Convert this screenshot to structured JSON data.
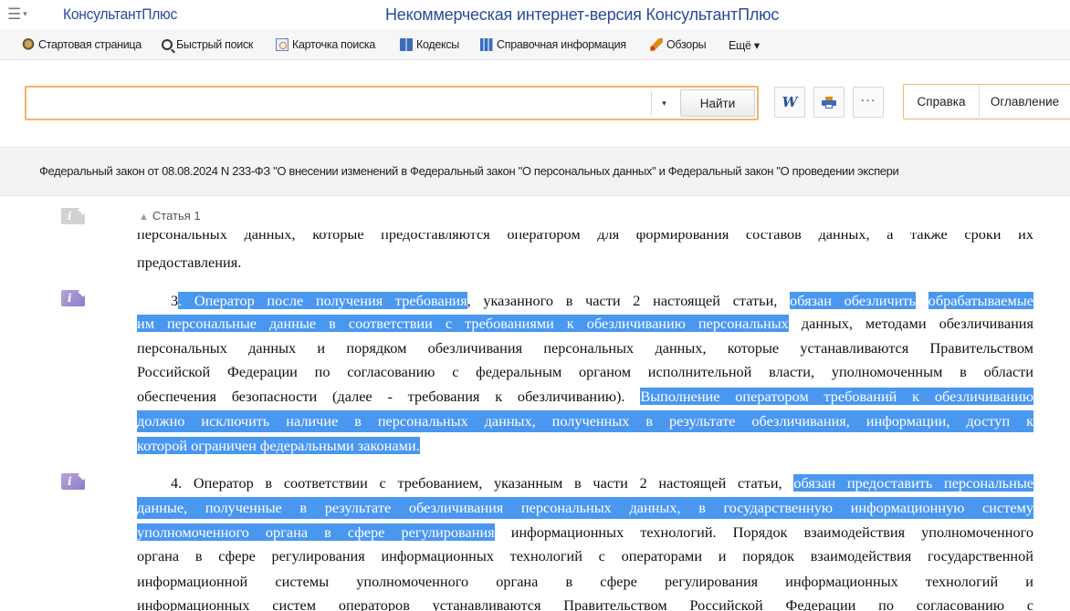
{
  "titlebar": {
    "brand": "КонсультантПлюс",
    "title": "Некоммерческая интернет-версия КонсультантПлюс",
    "menu_icon": "hamburger-menu-icon"
  },
  "toolbar": {
    "items": [
      {
        "label": "Стартовая страница",
        "icon": "home-icon"
      },
      {
        "label": "Быстрый поиск",
        "icon": "search-icon"
      },
      {
        "label": "Карточка поиска",
        "icon": "search-card-icon"
      },
      {
        "label": "Кодексы",
        "icon": "book-icon"
      },
      {
        "label": "Справочная информация",
        "icon": "reference-icon"
      },
      {
        "label": "Обзоры",
        "icon": "pen-icon"
      },
      {
        "label": "Ещё ▾",
        "icon": ""
      }
    ]
  },
  "search": {
    "value": "",
    "placeholder": "",
    "dropdown": "▾",
    "find_label": "Найти"
  },
  "actions": {
    "word_label": "W",
    "more_label": "···",
    "help_label": "Справка",
    "contents_label": "Оглавление"
  },
  "document": {
    "title": "Федеральный закон от 08.08.2024 N 233-ФЗ \"О внесении изменений в Федеральный закон \"О персональных данных\" и Федеральный закон \"О проведении экспери",
    "article_link": "Статья 1"
  },
  "body": {
    "cut_line": "персональных данных, которые предоставляются оператором для формирования составов данных, а также сроки их",
    "p2_end": "предоставления.",
    "p3": {
      "l1": [
        {
          "t": "3",
          "h": false
        },
        {
          "t": ". Оператор после получения требования",
          "h": true
        },
        {
          "t": ", указанного в части 2 настоящей статьи, ",
          "h": false
        },
        {
          "t": "обязан обезличить",
          "h": true
        },
        {
          "t": " ",
          "h": false
        },
        {
          "t": "обрабатываемые",
          "h": true
        }
      ],
      "l2": [
        {
          "t": "им персональные данные в соответствии с требованиями к обезличиванию персональных",
          "h": true
        },
        {
          "t": " данных, методами обезличивания",
          "h": false
        }
      ],
      "l3": "персональных данных и порядком обезличивания персональных данных, которые устанавливаются Правительством",
      "l4": "Российской Федерации по согласованию с федеральным органом исполнительной власти, уполномоченным в области",
      "l5": [
        {
          "t": "обеспечения безопасности (далее - требования к обезличиванию). ",
          "h": false
        },
        {
          "t": "Выполнение оператором требований к обезличиванию",
          "h": true
        }
      ],
      "l6": "должно исключить наличие в персональных данных, полученных в результате обезличивания, информации, доступ к",
      "l7": "которой ограничен федеральными законами."
    },
    "p4": {
      "l1": [
        {
          "t": "4. Оператор в соответствии с требованием, указанным в части 2 настоящей статьи, ",
          "h": false
        },
        {
          "t": "обязан предоставить персональные",
          "h": true
        }
      ],
      "l2": "данные, полученные в результате обезличивания персональных данных, в государственную информационную систему",
      "l3": [
        {
          "t": "уполномоченного органа в сфере регулирования",
          "h": true
        },
        {
          "t": " информационных технологий. Порядок взаимодействия уполномоченного",
          "h": false
        }
      ],
      "l4": "органа в сфере регулирования информационных технологий с операторами и порядок взаимодействия государственной",
      "l5": "информационной системы уполномоченного органа в сфере регулирования информационных технологий и",
      "l6": "информационных систем операторов устанавливаются Правительством Российской Федерации по согласованию с"
    }
  },
  "colors": {
    "highlight": "#4a97f0",
    "brand": "#2a4a9a",
    "accent_border": "#f0b66a"
  }
}
